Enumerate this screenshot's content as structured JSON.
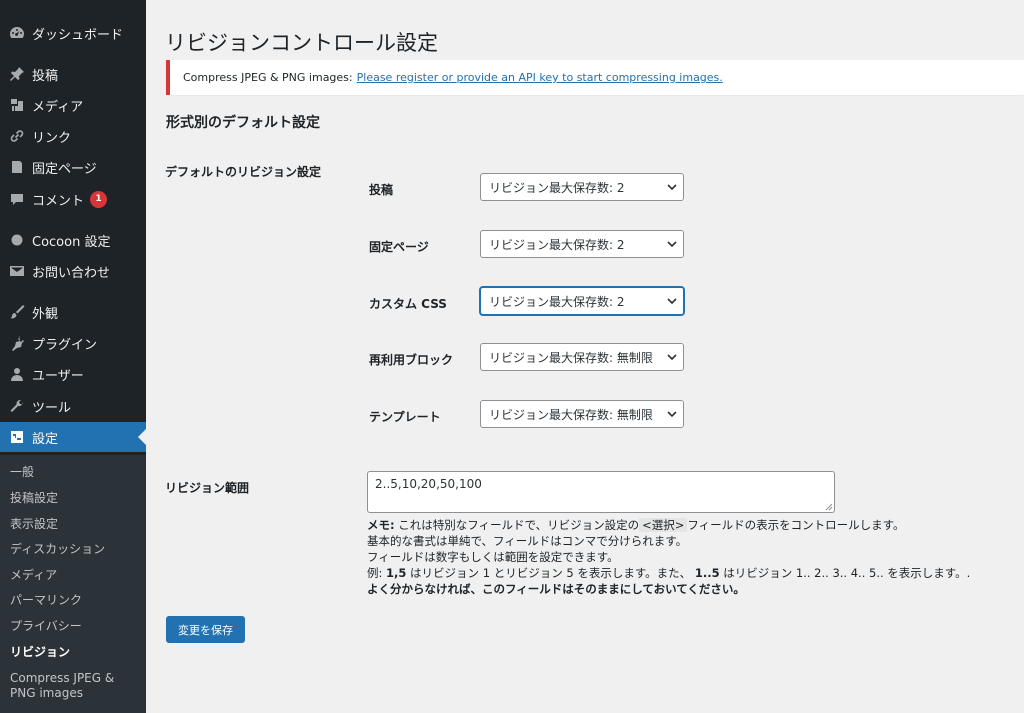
{
  "sidebar": {
    "items": [
      {
        "label": "ダッシュボード",
        "icon": "dashboard-icon"
      },
      {
        "label": "投稿",
        "icon": "pin-icon"
      },
      {
        "label": "メディア",
        "icon": "media-icon"
      },
      {
        "label": "リンク",
        "icon": "link-icon"
      },
      {
        "label": "固定ページ",
        "icon": "page-icon"
      },
      {
        "label": "コメント",
        "icon": "comment-icon",
        "badge": "1"
      },
      {
        "label": "Cocoon 設定",
        "icon": "cocoon-icon"
      },
      {
        "label": "お問い合わせ",
        "icon": "mail-icon"
      },
      {
        "label": "外観",
        "icon": "brush-icon"
      },
      {
        "label": "プラグイン",
        "icon": "plugin-icon"
      },
      {
        "label": "ユーザー",
        "icon": "user-icon"
      },
      {
        "label": "ツール",
        "icon": "wrench-icon"
      },
      {
        "label": "設定",
        "icon": "settings-icon",
        "active": true
      }
    ],
    "submenu": [
      "一般",
      "投稿設定",
      "表示設定",
      "ディスカッション",
      "メディア",
      "パーマリンク",
      "プライバシー",
      "リビジョン",
      "Compress JPEG & PNG images"
    ]
  },
  "page": {
    "title": "リビジョンコントロール設定",
    "notice_prefix": "Compress JPEG & PNG images:",
    "notice_link": "Please register or provide an API key to start compressing images.",
    "section_title": "形式別のデフォルト設定",
    "group_label": "デフォルトのリビジョン設定",
    "rows": [
      {
        "label": "投稿",
        "value": "リビジョン最大保存数: 2"
      },
      {
        "label": "固定ページ",
        "value": "リビジョン最大保存数: 2"
      },
      {
        "label": "カスタム CSS",
        "value": "リビジョン最大保存数: 2"
      },
      {
        "label": "再利用ブロック",
        "value": "リビジョン最大保存数: 無制限"
      },
      {
        "label": "テンプレート",
        "value": "リビジョン最大保存数: 無制限"
      }
    ],
    "range_label": "リビジョン範囲",
    "range_value": "2..5,10,20,50,100",
    "desc": {
      "l1_bold": "メモ:",
      "l1_a": " これは特別なフィールドで、リビジョン設定の",
      "l1_code": "<選択>",
      "l1_b": "フィールドの表示をコントロールします。",
      "l2": "基本的な書式は単純で、フィールドはコンマで分けられます。",
      "l3": "フィールドは数字もしくは範囲を設定できます。",
      "l4_a": "例: ",
      "l4_b1": "1,5",
      "l4_c": " はリビジョン 1 とリビジョン 5 を表示します。また、 ",
      "l4_b2": "1..5",
      "l4_d": " はリビジョン 1.. 2.. 3.. 4.. 5.. を表示します。.",
      "l5": "よく分からなければ、このフィールドはそのままにしておいてください。"
    },
    "save_label": "変更を保存"
  },
  "colors": {
    "sidebar_bg": "#1d2327",
    "submenu_bg": "#2c3338",
    "accent": "#2271b1",
    "notice_border": "#d63638",
    "badge": "#d63638"
  }
}
